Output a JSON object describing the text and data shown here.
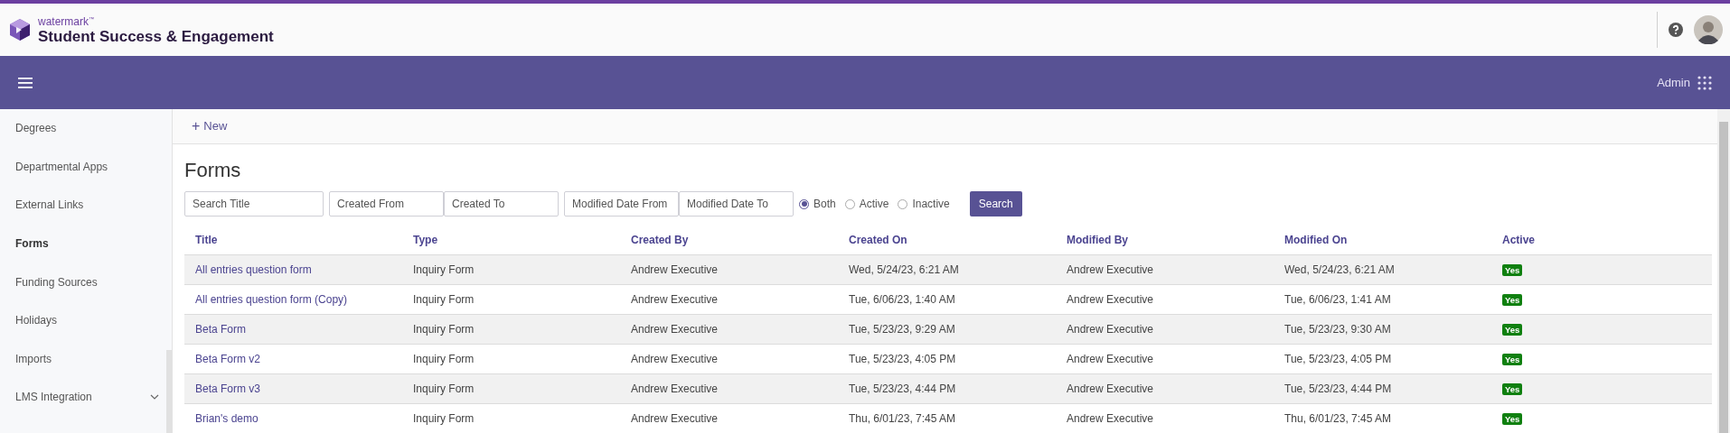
{
  "header": {
    "brand_small": "watermark",
    "brand_mark": "™",
    "brand_title": "Student Success & Engagement"
  },
  "navbar": {
    "admin_label": "Admin"
  },
  "sidebar": {
    "items": [
      {
        "label": "Degrees",
        "selected": false,
        "kind": "link"
      },
      {
        "label": "Departmental Apps",
        "selected": false,
        "kind": "link"
      },
      {
        "label": "External Links",
        "selected": false,
        "kind": "link"
      },
      {
        "label": "Forms",
        "selected": true,
        "kind": "link"
      },
      {
        "label": "Funding Sources",
        "selected": false,
        "kind": "link"
      },
      {
        "label": "Holidays",
        "selected": false,
        "kind": "link"
      },
      {
        "label": "Imports",
        "selected": false,
        "kind": "link"
      },
      {
        "label": "LMS Integration",
        "selected": false,
        "kind": "group"
      }
    ]
  },
  "toolbar": {
    "new_icon": "+",
    "new_label": "New"
  },
  "page_title": "Forms",
  "filters": {
    "field_groups": [
      [
        {
          "placeholder": "Search Title"
        }
      ],
      [
        {
          "placeholder": "Created From"
        },
        {
          "placeholder": "Created To"
        }
      ],
      [
        {
          "placeholder": "Modified Date From"
        },
        {
          "placeholder": "Modified Date To"
        }
      ]
    ],
    "radios": [
      {
        "label": "Both",
        "selected": true
      },
      {
        "label": "Active",
        "selected": false
      },
      {
        "label": "Inactive",
        "selected": false
      }
    ],
    "search_button": "Search"
  },
  "table": {
    "columns": [
      "Title",
      "Type",
      "Created By",
      "Created On",
      "Modified By",
      "Modified On",
      "Active"
    ],
    "rows": [
      {
        "title": "All entries question form",
        "type": "Inquiry Form",
        "created_by": "Andrew Executive",
        "created_on": "Wed, 5/24/23, 6:21 AM",
        "modified_by": "Andrew Executive",
        "modified_on": "Wed, 5/24/23, 6:21 AM",
        "active": "Yes"
      },
      {
        "title": "All entries question form (Copy)",
        "type": "Inquiry Form",
        "created_by": "Andrew Executive",
        "created_on": "Tue, 6/06/23, 1:40 AM",
        "modified_by": "Andrew Executive",
        "modified_on": "Tue, 6/06/23, 1:41 AM",
        "active": "Yes"
      },
      {
        "title": "Beta Form",
        "type": "Inquiry Form",
        "created_by": "Andrew Executive",
        "created_on": "Tue, 5/23/23, 9:29 AM",
        "modified_by": "Andrew Executive",
        "modified_on": "Tue, 5/23/23, 9:30 AM",
        "active": "Yes"
      },
      {
        "title": "Beta Form v2",
        "type": "Inquiry Form",
        "created_by": "Andrew Executive",
        "created_on": "Tue, 5/23/23, 4:05 PM",
        "modified_by": "Andrew Executive",
        "modified_on": "Tue, 5/23/23, 4:05 PM",
        "active": "Yes"
      },
      {
        "title": "Beta Form v3",
        "type": "Inquiry Form",
        "created_by": "Andrew Executive",
        "created_on": "Tue, 5/23/23, 4:44 PM",
        "modified_by": "Andrew Executive",
        "modified_on": "Tue, 5/23/23, 4:44 PM",
        "active": "Yes"
      },
      {
        "title": "Brian's demo",
        "type": "Inquiry Form",
        "created_by": "Andrew Executive",
        "created_on": "Thu, 6/01/23, 7:45 AM",
        "modified_by": "Andrew Executive",
        "modified_on": "Thu, 6/01/23, 7:45 AM",
        "active": "Yes"
      }
    ]
  }
}
